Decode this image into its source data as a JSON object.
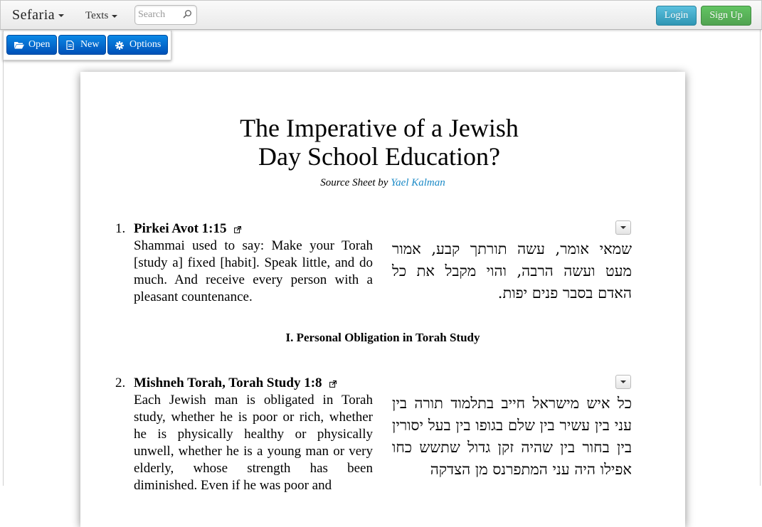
{
  "nav": {
    "brand": "Sefaria",
    "texts_label": "Texts",
    "search_placeholder": "Search",
    "login_label": "Login",
    "signup_label": "Sign Up"
  },
  "toolbar": {
    "open_label": "Open",
    "new_label": "New",
    "options_label": "Options"
  },
  "sheet": {
    "title_line1": "The Imperative of a Jewish",
    "title_line2": "Day School Education?",
    "byline_prefix": "Source Sheet by",
    "author": "Yael Kalman",
    "sources": [
      {
        "number": "1.",
        "title": "Pirkei Avot 1:15",
        "english": "Shammai used to say: Make your Torah [study a] fixed [habit]. Speak little, and do much. And receive every person with a pleasant countenance.",
        "hebrew": "שמאי אומר, עשה תורתך קבע, אמור מעט ועשה הרבה, והוי מקבל את כל האדם בסבר פנים יפות."
      },
      {
        "number": "2.",
        "title": "Mishneh Torah, Torah Study 1:8",
        "english": "Each Jewish man is obligated in Torah study, whether he is poor or rich, whether he is physically healthy or physically unwell, whether he is a young man or very elderly, whose strength has been diminished. Even if he was poor and",
        "hebrew": "כל איש מישראל חייב בתלמוד תורה בין עני בין עשיר בין שלם בגופו בין בעל יסורין בין בחור בין שהיה זקן גדול שתשש כחו אפילו היה עני המתפרנס מן הצדקה"
      }
    ],
    "section_header": "I. Personal Obligation in Torah Study"
  }
}
